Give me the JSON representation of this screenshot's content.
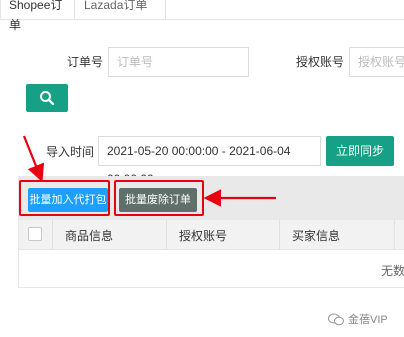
{
  "tabs": [
    {
      "label": "Shopee订单"
    },
    {
      "label": "Lazada订单"
    }
  ],
  "filters": {
    "order_no_label": "订单号",
    "order_no_placeholder": "订单号",
    "account_label": "授权账号",
    "account_placeholder": "授权账号",
    "import_time_label": "导入时间",
    "import_time_value": "2021-05-20 00:00:00 - 2021-06-04 00:00:00"
  },
  "actions": {
    "search_icon": "search-icon",
    "sync_label": "立即同步",
    "batch_add_label": "批量加入代打包",
    "batch_delete_label": "批量废除订单"
  },
  "table": {
    "columns": [
      "商品信息",
      "授权账号",
      "买家信息"
    ],
    "empty_text": "无数"
  },
  "watermark": {
    "text": "金蓓VIP"
  },
  "colors": {
    "primary_green": "#16a085",
    "primary_blue": "#1e9fff",
    "annotation_red": "#e60012"
  }
}
